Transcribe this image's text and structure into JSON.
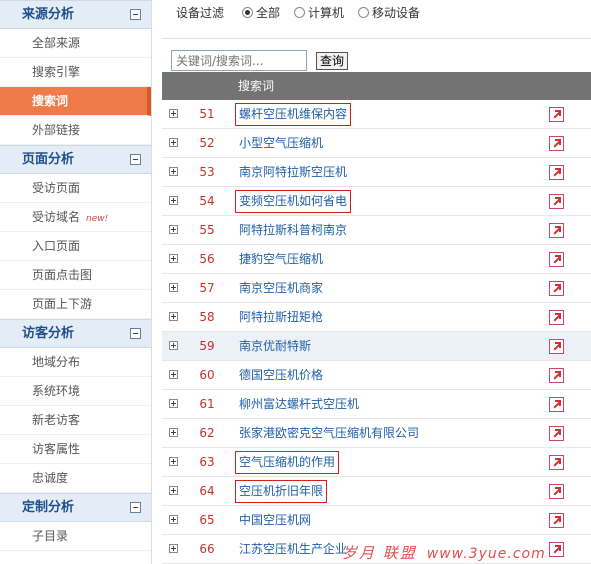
{
  "sidebar": {
    "sections": [
      {
        "title": "来源分析",
        "items": [
          {
            "label": "全部来源",
            "active": false
          },
          {
            "label": "搜索引擎",
            "active": false
          },
          {
            "label": "搜索词",
            "active": true
          },
          {
            "label": "外部链接",
            "active": false
          }
        ]
      },
      {
        "title": "页面分析",
        "items": [
          {
            "label": "受访页面",
            "active": false
          },
          {
            "label": "受访域名",
            "badge": "new!",
            "active": false
          },
          {
            "label": "入口页面",
            "active": false
          },
          {
            "label": "页面点击图",
            "active": false
          },
          {
            "label": "页面上下游",
            "active": false
          }
        ]
      },
      {
        "title": "访客分析",
        "items": [
          {
            "label": "地域分布",
            "active": false
          },
          {
            "label": "系统环境",
            "active": false
          },
          {
            "label": "新老访客",
            "active": false
          },
          {
            "label": "访客属性",
            "active": false
          },
          {
            "label": "忠诚度",
            "active": false
          }
        ]
      },
      {
        "title": "定制分析",
        "items": [
          {
            "label": "子目录",
            "active": false
          }
        ]
      }
    ]
  },
  "filter": {
    "label": "设备过滤",
    "options": [
      {
        "label": "全部",
        "checked": true
      },
      {
        "label": "计算机",
        "checked": false
      },
      {
        "label": "移动设备",
        "checked": false
      }
    ]
  },
  "search": {
    "placeholder": "关键词/搜索词...",
    "button": "查询"
  },
  "table": {
    "header_term": "搜索词",
    "rows": [
      {
        "num": "51",
        "term": "螺杆空压机维保内容",
        "boxed": true,
        "hl": false
      },
      {
        "num": "52",
        "term": "小型空气压缩机",
        "boxed": false,
        "hl": false
      },
      {
        "num": "53",
        "term": "南京阿特拉斯空压机",
        "boxed": false,
        "hl": false
      },
      {
        "num": "54",
        "term": "变频空压机如何省电",
        "boxed": true,
        "hl": false
      },
      {
        "num": "55",
        "term": "阿特拉斯科普柯南京",
        "boxed": false,
        "hl": false
      },
      {
        "num": "56",
        "term": "捷豹空气压缩机",
        "boxed": false,
        "hl": false
      },
      {
        "num": "57",
        "term": "南京空压机商家",
        "boxed": false,
        "hl": false
      },
      {
        "num": "58",
        "term": "阿特拉斯扭矩枪",
        "boxed": false,
        "hl": false
      },
      {
        "num": "59",
        "term": "南京优耐特斯",
        "boxed": false,
        "hl": true
      },
      {
        "num": "60",
        "term": "德国空压机价格",
        "boxed": false,
        "hl": false
      },
      {
        "num": "61",
        "term": "柳州富达螺杆式空压机",
        "boxed": false,
        "hl": false
      },
      {
        "num": "62",
        "term": "张家港欧密克空气压缩机有限公司",
        "boxed": false,
        "hl": false
      },
      {
        "num": "63",
        "term": "空气压缩机的作用",
        "boxed": true,
        "hl": false
      },
      {
        "num": "64",
        "term": "空压机折旧年限",
        "boxed": true,
        "hl": false
      },
      {
        "num": "65",
        "term": "中国空压机网",
        "boxed": false,
        "hl": false
      },
      {
        "num": "66",
        "term": "江苏空压机生产企业",
        "boxed": false,
        "hl": false
      }
    ]
  },
  "watermark": {
    "text": "岁月 联盟",
    "url": "www.3yue.com"
  },
  "colors": {
    "active_nav": "#ef7a4a",
    "section_head": "#e4ecf5",
    "table_header": "#737373",
    "row_number": "#c9302c",
    "term_link": "#1f5fa8",
    "highlight_box": "#d21f1f"
  }
}
